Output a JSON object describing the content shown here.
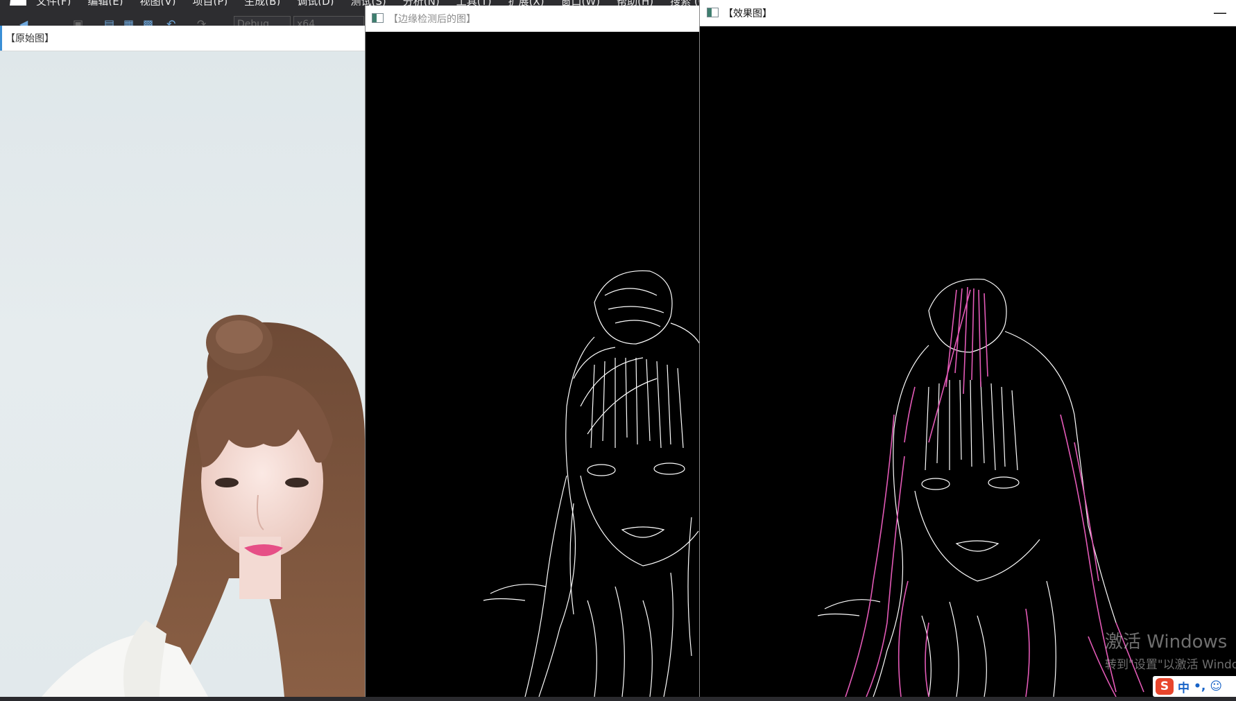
{
  "vs": {
    "menu": [
      "文件(F)",
      "编辑(E)",
      "视图(V)",
      "项目(P)",
      "生成(B)",
      "调试(D)",
      "测试(S)",
      "分析(N)",
      "工具(T)",
      "扩展(X)",
      "窗口(W)",
      "帮助(H)",
      "搜索 (C"
    ],
    "config": "Debug",
    "platform": "x64"
  },
  "windows": {
    "original": {
      "title": "【原始图】"
    },
    "edges": {
      "title": "【边缘检测后的图】"
    },
    "effect": {
      "title": "【效果图】",
      "minimize": "—"
    }
  },
  "watermark": {
    "line1": "激活 Windows",
    "line2": "转到\"设置\"以激活 Windo"
  },
  "ime": {
    "logo": "S",
    "mode": "中",
    "punct": "•,",
    "emoji": "☺"
  },
  "colors": {
    "vs_dark": "#2d2d30",
    "edge_white": "#ffffff",
    "effect_pink": "#e35ab7",
    "background_pale": "#e2e9ec"
  }
}
